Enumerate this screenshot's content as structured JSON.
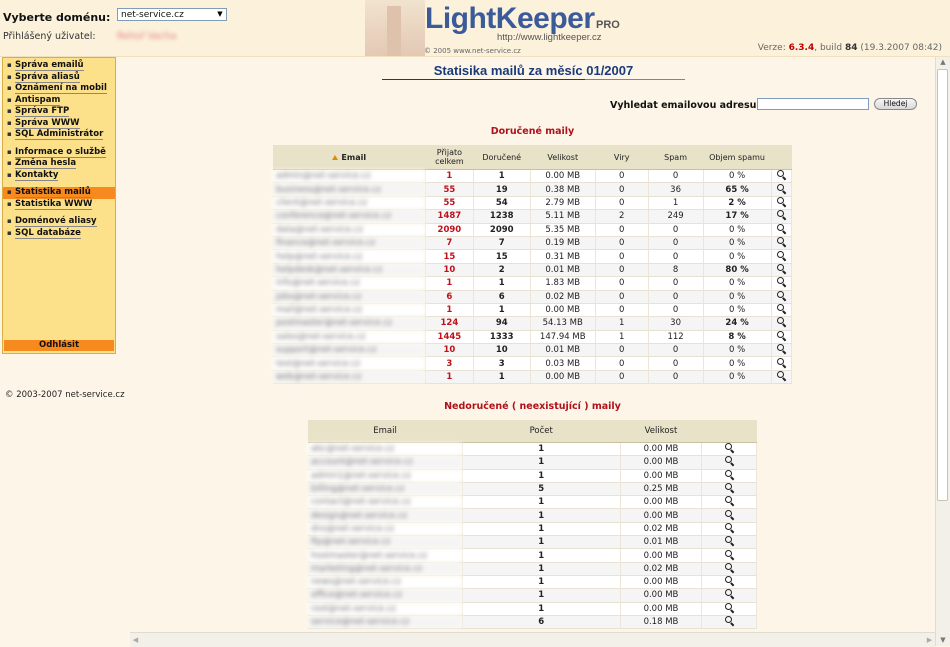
{
  "header": {
    "domain_label": "Vyberte doménu:",
    "domain_value": "net-service.cz",
    "user_label": "Přihlášený uživatel:",
    "user_value": "Řehoř Vacha",
    "logo_title": "LightKeeper",
    "logo_pro": "PRO",
    "logo_url": "http://www.lightkeeper.cz",
    "logo_copy": "© 2005 www.net-service.cz",
    "version_prefix": "Verze:",
    "version_number": "6.3.4",
    "build_prefix": ", build",
    "build_number": "84",
    "build_date": "(19.3.2007 08:42)"
  },
  "sidebar": {
    "groups": [
      [
        "Správa emailů",
        "Správa aliasů",
        "Oznámení na mobil",
        "Antispam",
        "Správa FTP",
        "Správa WWW",
        "SQL Administrátor"
      ],
      [
        "Informace o službě",
        "Změna hesla",
        "Kontakty"
      ],
      [
        "Statistika mailů",
        "Statistika WWW"
      ],
      [
        "Doménové aliasy",
        "SQL databáze"
      ]
    ],
    "active": "Statistika mailů",
    "logout": "Odhlásit",
    "copyright": "© 2003-2007 net-service.cz"
  },
  "main": {
    "title": "Statisika mailů za měsíc 01/2007",
    "search_label": "Vyhledat emailovou adresu:",
    "search_value": "",
    "search_button": "Hledej",
    "delivered_title": "Doručené maily",
    "undelivered_title": "Nedoručené ( neexistující ) maily"
  },
  "delivered": {
    "headers": [
      "Email",
      "Přijato celkem",
      "Doručené",
      "Velikost",
      "Viry",
      "Spam",
      "Objem spamu"
    ],
    "rows": [
      [
        "admin@net-service.cz",
        "1",
        "1",
        "0.00 MB",
        "0",
        "0",
        "0 %"
      ],
      [
        "business@net-service.cz",
        "55",
        "19",
        "0.38 MB",
        "0",
        "36",
        "65 %"
      ],
      [
        "client@net-service.cz",
        "55",
        "54",
        "2.79 MB",
        "0",
        "1",
        "2 %"
      ],
      [
        "conference@net-service.cz",
        "1487",
        "1238",
        "5.11 MB",
        "2",
        "249",
        "17 %"
      ],
      [
        "data@net-service.cz",
        "2090",
        "2090",
        "5.35 MB",
        "0",
        "0",
        "0 %"
      ],
      [
        "finance@net-service.cz",
        "7",
        "7",
        "0.19 MB",
        "0",
        "0",
        "0 %"
      ],
      [
        "help@net-service.cz",
        "15",
        "15",
        "0.31 MB",
        "0",
        "0",
        "0 %"
      ],
      [
        "helpdesk@net-service.cz",
        "10",
        "2",
        "0.01 MB",
        "0",
        "8",
        "80 %"
      ],
      [
        "info@net-service.cz",
        "1",
        "1",
        "1.83 MB",
        "0",
        "0",
        "0 %"
      ],
      [
        "jobs@net-service.cz",
        "6",
        "6",
        "0.02 MB",
        "0",
        "0",
        "0 %"
      ],
      [
        "mail@net-service.cz",
        "1",
        "1",
        "0.00 MB",
        "0",
        "0",
        "0 %"
      ],
      [
        "postmaster@net-service.cz",
        "124",
        "94",
        "54.13 MB",
        "1",
        "30",
        "24 %"
      ],
      [
        "sales@net-service.cz",
        "1445",
        "1333",
        "147.94 MB",
        "1",
        "112",
        "8 %"
      ],
      [
        "support@net-service.cz",
        "10",
        "10",
        "0.01 MB",
        "0",
        "0",
        "0 %"
      ],
      [
        "test@net-service.cz",
        "3",
        "3",
        "0.03 MB",
        "0",
        "0",
        "0 %"
      ],
      [
        "web@net-service.cz",
        "1",
        "1",
        "0.00 MB",
        "0",
        "0",
        "0 %"
      ]
    ]
  },
  "undelivered": {
    "headers": [
      "Email",
      "Počet",
      "Velikost"
    ],
    "rows": [
      [
        "abc@net-service.cz",
        "1",
        "0.00 MB"
      ],
      [
        "account@net-service.cz",
        "1",
        "0.00 MB"
      ],
      [
        "admin1@net-service.cz",
        "1",
        "0.00 MB"
      ],
      [
        "billing@net-service.cz",
        "5",
        "0.25 MB"
      ],
      [
        "contact@net-service.cz",
        "1",
        "0.00 MB"
      ],
      [
        "design@net-service.cz",
        "1",
        "0.00 MB"
      ],
      [
        "dns@net-service.cz",
        "1",
        "0.02 MB"
      ],
      [
        "ftp@net-service.cz",
        "1",
        "0.01 MB"
      ],
      [
        "hostmaster@net-service.cz",
        "1",
        "0.00 MB"
      ],
      [
        "marketing@net-service.cz",
        "1",
        "0.02 MB"
      ],
      [
        "news@net-service.cz",
        "1",
        "0.00 MB"
      ],
      [
        "office@net-service.cz",
        "1",
        "0.00 MB"
      ],
      [
        "root@net-service.cz",
        "1",
        "0.00 MB"
      ],
      [
        "service@net-service.cz",
        "6",
        "0.18 MB"
      ]
    ]
  },
  "colors": {
    "accent_orange": "#f78a1e",
    "sidebar_bg": "#fde18a",
    "title_blue": "#1a3a7a",
    "red": "#c0101a"
  }
}
